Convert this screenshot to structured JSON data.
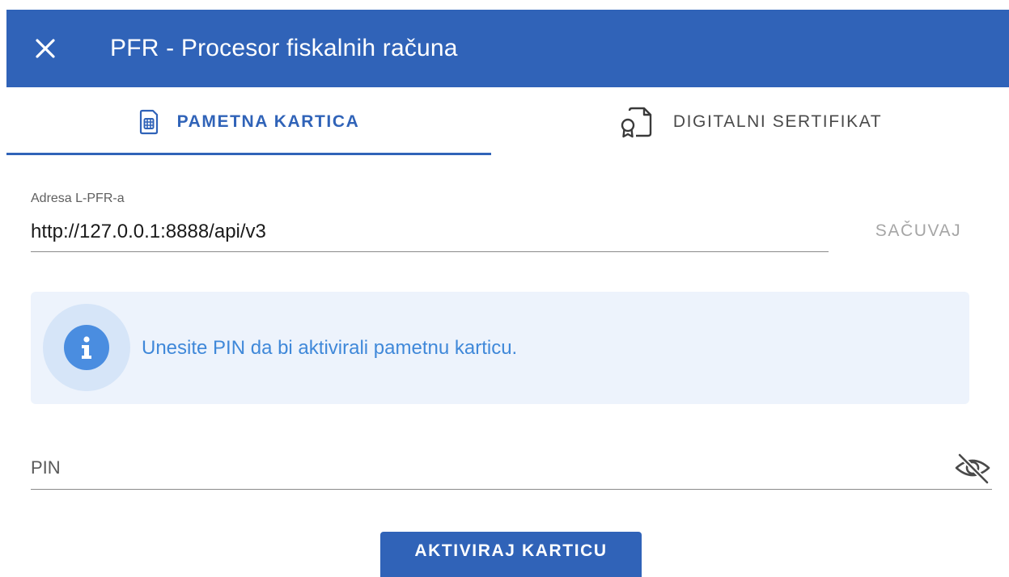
{
  "header": {
    "title": "PFR - Procesor fiskalnih računa",
    "close_icon": "close-icon",
    "background_color": "#3063b8"
  },
  "tabs": [
    {
      "label": "PAMETNA KARTICA",
      "icon": "smart-card-icon",
      "active": true
    },
    {
      "label": "DIGITALNI SERTIFIKAT",
      "icon": "certificate-icon",
      "active": false
    }
  ],
  "address": {
    "label": "Adresa L-PFR-a",
    "value": "http://127.0.0.1:8888/api/v3",
    "save_label": "SAČUVAJ"
  },
  "info": {
    "icon": "info-icon",
    "message": "Unesite PIN da bi aktivirali pametnu karticu."
  },
  "pin": {
    "placeholder": "PIN",
    "toggle_icon": "eye-off-icon"
  },
  "actions": {
    "activate_label": "AKTIVIRAJ KARTICU"
  }
}
